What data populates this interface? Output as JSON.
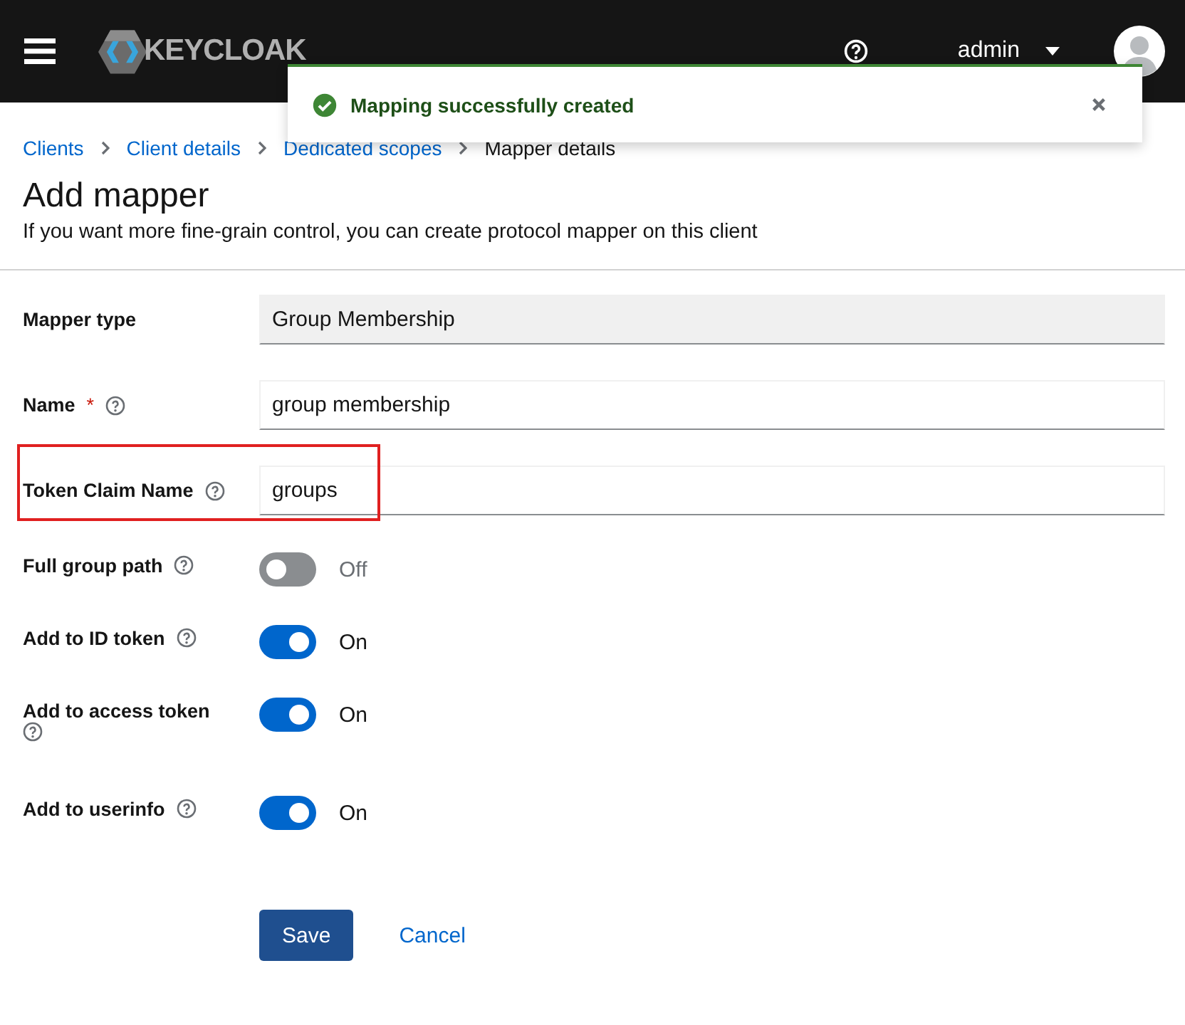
{
  "header": {
    "brand": "KEYCLOAK",
    "user": "admin"
  },
  "toast": {
    "message": "Mapping successfully created"
  },
  "breadcrumb": [
    {
      "label": "Clients",
      "link": true
    },
    {
      "label": "Client details",
      "link": true
    },
    {
      "label": "Dedicated scopes",
      "link": true
    },
    {
      "label": "Mapper details",
      "link": false
    }
  ],
  "page": {
    "title": "Add mapper",
    "subtitle": "If you want more fine-grain control, you can create protocol mapper on this client"
  },
  "fields": [
    {
      "kind": "readonly",
      "label": "Mapper type",
      "help": false,
      "value": "Group Membership",
      "highlighted": false
    },
    {
      "kind": "text",
      "label": "Name",
      "help": true,
      "required_mark": "*",
      "value": "group membership",
      "highlighted": false
    },
    {
      "kind": "text",
      "label": "Token Claim Name",
      "help": true,
      "value": "groups",
      "highlighted": true
    },
    {
      "kind": "switch",
      "label": "Full group path",
      "help": true,
      "on": false,
      "state_text": "Off"
    },
    {
      "kind": "switch",
      "label": "Add to ID token",
      "help": true,
      "on": true,
      "state_text": "On"
    },
    {
      "kind": "switch",
      "label": "Add to access token",
      "help": true,
      "on": true,
      "state_text": "On"
    },
    {
      "kind": "switch",
      "label": "Add to userinfo",
      "help": true,
      "on": true,
      "state_text": "On"
    }
  ],
  "buttons": {
    "save": "Save",
    "cancel": "Cancel"
  }
}
